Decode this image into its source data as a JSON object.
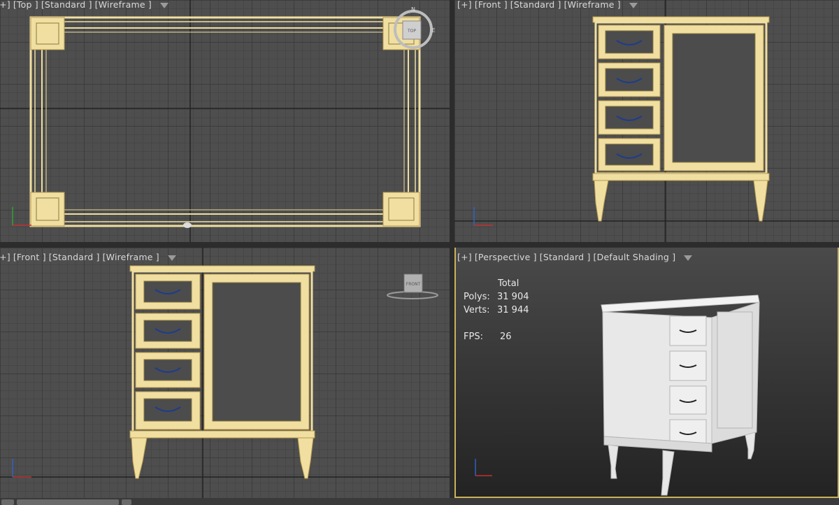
{
  "viewports": {
    "top": {
      "plus": "[+]",
      "view": "[Top ]",
      "shading": "[Standard ]",
      "mode": "[Wireframe ]"
    },
    "front_right": {
      "plus": "[+]",
      "view": "[Front ]",
      "shading": "[Standard ]",
      "mode": "[Wireframe ]"
    },
    "front_left": {
      "plus": "[+]",
      "view": "[Front ]",
      "shading": "[Standard ]",
      "mode": "[Wireframe ]"
    },
    "perspective": {
      "plus": "[+]",
      "view": "[Perspective ]",
      "shading": "[Standard ]",
      "mode": "[Default Shading ]"
    }
  },
  "stats": {
    "total_label": "Total",
    "polys_label": "Polys:",
    "polys_value": "31 904",
    "verts_label": "Verts:",
    "verts_value": "31 944",
    "fps_label": "FPS:",
    "fps_value": "26"
  },
  "viewcube": {
    "north": "N",
    "east": "E",
    "face_top": "TOP",
    "face_front": "FRONT"
  },
  "icons": [
    "filter-icon",
    "viewcube-icon",
    "axis-gizmo-icon"
  ],
  "colors": {
    "wireframe": "#f0dfa0",
    "accent_border": "#c9b35a",
    "handle": "#1e3c8c"
  }
}
